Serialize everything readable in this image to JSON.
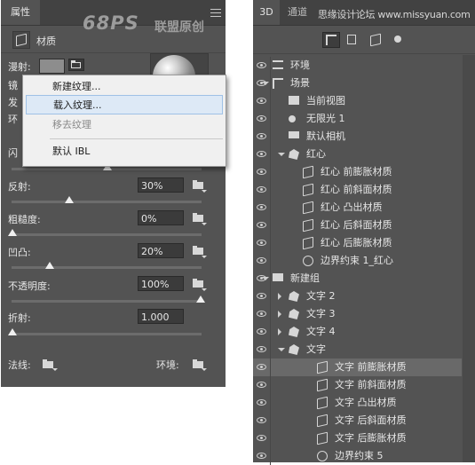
{
  "left_panel": {
    "tab": "属性",
    "watermark": "68PS",
    "watermark_cn": "联盟原创",
    "header": {
      "label": "材质"
    },
    "rows": {
      "diffuse": "漫射:",
      "specular": "镜",
      "glow": "发",
      "ambient": "环",
      "shine": "闪",
      "reflection": "反射:",
      "roughness": "粗糙度:",
      "bump": "凹凸:",
      "opacity": "不透明度:",
      "refraction": "折射:",
      "normal": "法线:",
      "environment": "环境:"
    },
    "values": {
      "reflection": "30%",
      "roughness": "0%",
      "bump": "20%",
      "opacity": "100%",
      "refraction": "1.000"
    },
    "sliders": {
      "shine": 0.47,
      "reflection": 0.27,
      "roughness": 0.0,
      "bump": 0.2,
      "opacity": 1.0,
      "refraction": 0.0
    },
    "menu": {
      "new_texture": "新建纹理...",
      "load_texture": "载入纹理...",
      "remove_texture": "移去纹理",
      "default_ibl": "默认 IBL"
    }
  },
  "right_panel": {
    "tabs": [
      "3D",
      "通道"
    ],
    "watermark": "思缘设计论坛 www.missyuan.com",
    "layers": [
      {
        "label": "环境",
        "icon": "environment-icon"
      },
      {
        "label": "场景",
        "icon": "scene-icon"
      },
      {
        "label": "当前视图",
        "icon": "view-icon"
      },
      {
        "label": "无限光 1",
        "icon": "light-icon"
      },
      {
        "label": "默认相机",
        "icon": "camera-icon"
      },
      {
        "label": "红心",
        "icon": "mesh-icon"
      },
      {
        "label": "红心 前膨胀材质",
        "icon": "material-icon"
      },
      {
        "label": "红心 前斜面材质",
        "icon": "material-icon"
      },
      {
        "label": "红心 凸出材质",
        "icon": "material-icon"
      },
      {
        "label": "红心 后斜面材质",
        "icon": "material-icon"
      },
      {
        "label": "红心 后膨胀材质",
        "icon": "material-icon"
      },
      {
        "label": "边界约束 1_红心",
        "icon": "constraint-icon"
      },
      {
        "label": "新建组",
        "icon": "folder-icon"
      },
      {
        "label": "文字 2",
        "icon": "mesh-icon"
      },
      {
        "label": "文字 3",
        "icon": "mesh-icon"
      },
      {
        "label": "文字 4",
        "icon": "mesh-icon"
      },
      {
        "label": "文字",
        "icon": "mesh-icon"
      },
      {
        "label": "文字 前膨胀材质",
        "icon": "material-icon"
      },
      {
        "label": "文字 前斜面材质",
        "icon": "material-icon"
      },
      {
        "label": "文字 凸出材质",
        "icon": "material-icon"
      },
      {
        "label": "文字 后斜面材质",
        "icon": "material-icon"
      },
      {
        "label": "文字 后膨胀材质",
        "icon": "material-icon"
      },
      {
        "label": "边界约束 5",
        "icon": "constraint-icon"
      }
    ],
    "selected_layer": "文字 前膨胀材质"
  }
}
